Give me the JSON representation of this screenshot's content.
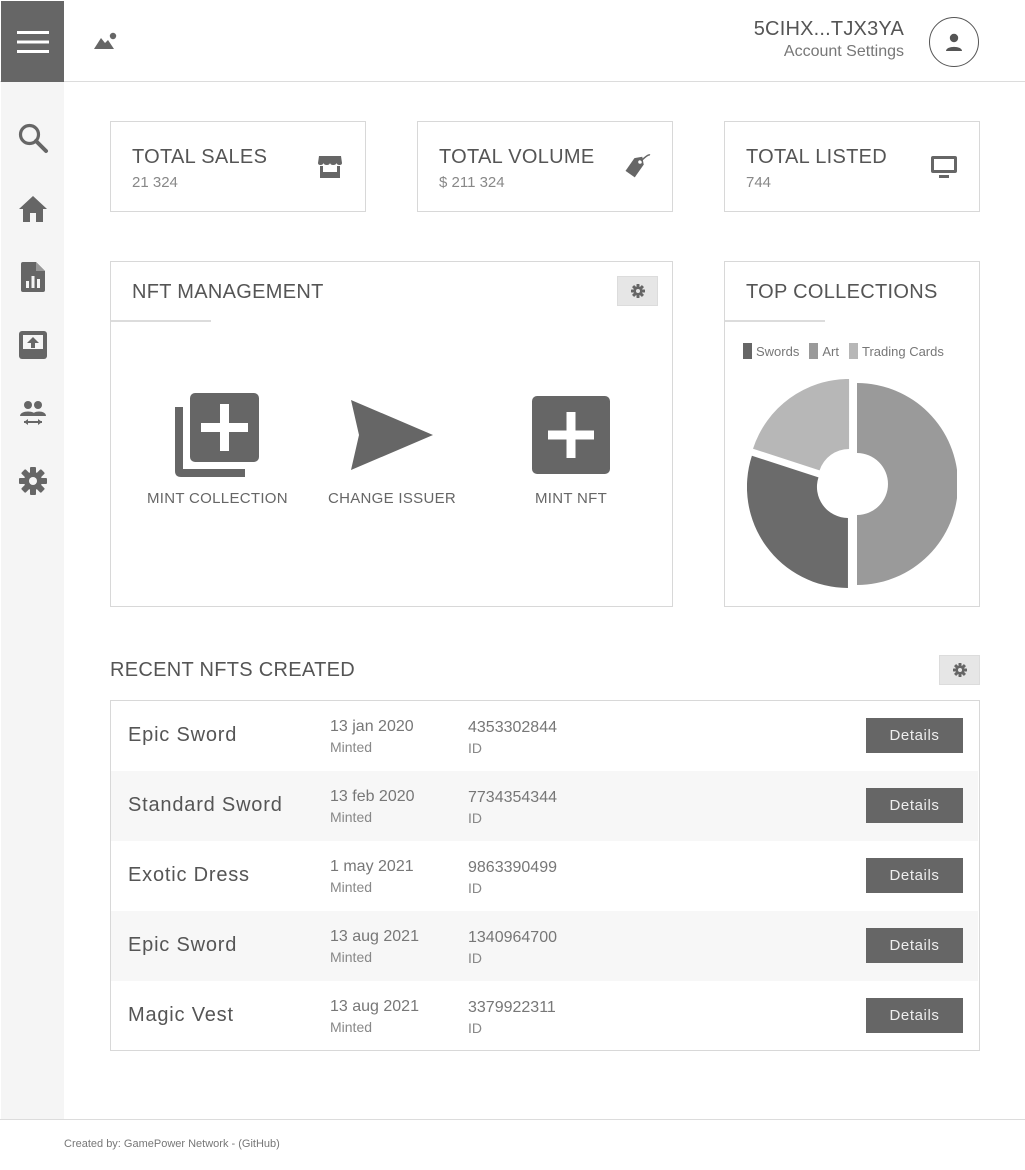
{
  "header": {
    "account_id": "5CIHX...TJX3YA",
    "account_settings": "Account Settings"
  },
  "sidebar": {
    "items": [
      {
        "icon": "search-icon"
      },
      {
        "icon": "home-icon"
      },
      {
        "icon": "report-icon"
      },
      {
        "icon": "upload-icon"
      },
      {
        "icon": "transfer-users-icon"
      },
      {
        "icon": "gear-icon"
      }
    ]
  },
  "stats": {
    "total_sales": {
      "label": "TOTAL SALES",
      "value": "21 324",
      "icon": "store-icon"
    },
    "total_volume": {
      "label": "TOTAL VOLUME",
      "value": "$ 211 324",
      "icon": "tag-icon"
    },
    "total_listed": {
      "label": "TOTAL LISTED",
      "value": "744",
      "icon": "monitor-icon"
    }
  },
  "nft_management": {
    "title": "NFT MANAGEMENT",
    "actions": [
      {
        "label": "MINT COLLECTION",
        "icon": "library-add-icon"
      },
      {
        "label": "CHANGE ISSUER",
        "icon": "send-icon"
      },
      {
        "label": "MINT NFT",
        "icon": "add-box-icon"
      }
    ]
  },
  "top_collections": {
    "title": "TOP COLLECTIONS"
  },
  "chart_data": {
    "type": "pie",
    "title": "TOP COLLECTIONS",
    "donut": true,
    "legend_position": "top",
    "categories": [
      "Swords",
      "Art",
      "Trading Cards"
    ],
    "values": [
      50,
      30,
      20
    ],
    "colors": [
      "#9a9a9a",
      "#6b6b6b",
      "#b7b7b7"
    ],
    "legend_colors": [
      "#666666",
      "#9a9a9a",
      "#b7b7b7"
    ]
  },
  "recent": {
    "title": "RECENT NFTS CREATED",
    "rows": [
      {
        "name": "Epic Sword",
        "date": "13 jan 2020",
        "status": "Minted",
        "id": "4353302844",
        "id_label": "ID",
        "button": "Details"
      },
      {
        "name": "Standard Sword",
        "date": "13 feb 2020",
        "status": "Minted",
        "id": "7734354344",
        "id_label": "ID",
        "button": "Details"
      },
      {
        "name": "Exotic Dress",
        "date": "1 may 2021",
        "status": "Minted",
        "id": "9863390499",
        "id_label": "ID",
        "button": "Details"
      },
      {
        "name": "Epic Sword",
        "date": "13 aug 2021",
        "status": "Minted",
        "id": "1340964700",
        "id_label": "ID",
        "button": "Details"
      },
      {
        "name": "Magic Vest",
        "date": "13 aug 2021",
        "status": "Minted",
        "id": "3379922311",
        "id_label": "ID",
        "button": "Details"
      }
    ]
  },
  "footer": {
    "text": "Created by: GamePower Network - (GitHub)"
  }
}
